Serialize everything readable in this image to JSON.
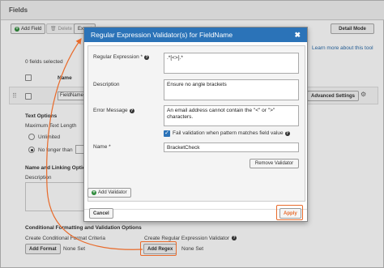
{
  "background": {
    "section_title": "Fields",
    "toolbar": {
      "add_field": "Add Field",
      "delete": "Delete",
      "export": "Export",
      "detail_mode": "Detail Mode"
    },
    "learn_more": "Learn more about this tool",
    "fields_selected": "0 fields selected",
    "name_col": "Name",
    "field_name_value": "FieldName",
    "advanced_settings": "Advanced Settings",
    "text_options": "Text Options",
    "max_text_length": "Maximum Text Length",
    "unlimited": "Unlimited",
    "no_longer_than": "No longer than",
    "name_linking": "Name and Linking Options",
    "description": "Description",
    "conditional_section": "Conditional Formatting and Validation Options",
    "create_cond_format": "Create Conditional Format Criteria",
    "add_format": "Add Format",
    "none_set_1": "None Set",
    "create_regex": "Create Regular Expression Validator",
    "add_regex": "Add Regex",
    "none_set_2": "None Set"
  },
  "modal": {
    "title": "Regular Expression Validator(s) for FieldName",
    "close_glyph": "✖",
    "regex_label": "Regular Expression *",
    "regex_value": ".*[<>].*",
    "description_label": "Description",
    "description_value": "Ensure no angle brackets",
    "error_label": "Error Message",
    "error_value": "An email address cannot contain the \"<\" or \">\" characters.",
    "fail_label": "Fail validation when pattern matches field value",
    "fail_checked": true,
    "name_label": "Name *",
    "name_value": "BracketCheck",
    "remove_validator": "Remove Validator",
    "add_validator": "Add Validator",
    "cancel": "Cancel",
    "apply": "Apply"
  },
  "colors": {
    "header_blue": "#2b73b8",
    "highlight_orange": "#e86a2a"
  }
}
